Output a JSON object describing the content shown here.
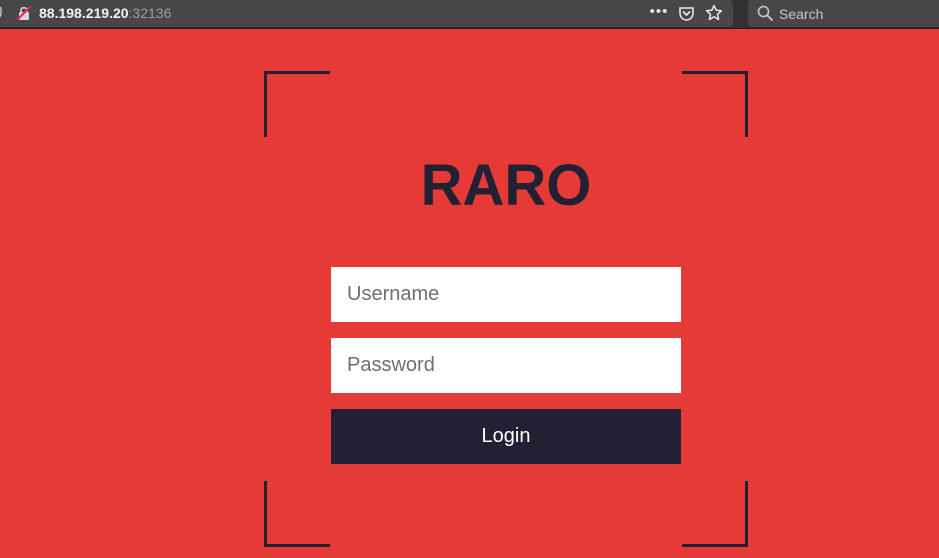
{
  "browser": {
    "url_host": "88.198.219.20",
    "url_port": ":32136",
    "more_glyph": "•••",
    "search_placeholder": "Search",
    "icons": [
      "shield-icon",
      "insecure-lock-icon",
      "more-icon",
      "pocket-icon",
      "star-icon",
      "search-icon"
    ]
  },
  "login": {
    "brand": "RARO",
    "username_placeholder": "Username",
    "password_placeholder": "Password",
    "login_label": "Login"
  },
  "colors": {
    "background": "#e63a37",
    "dark": "#222134",
    "field": "#ffffff"
  }
}
